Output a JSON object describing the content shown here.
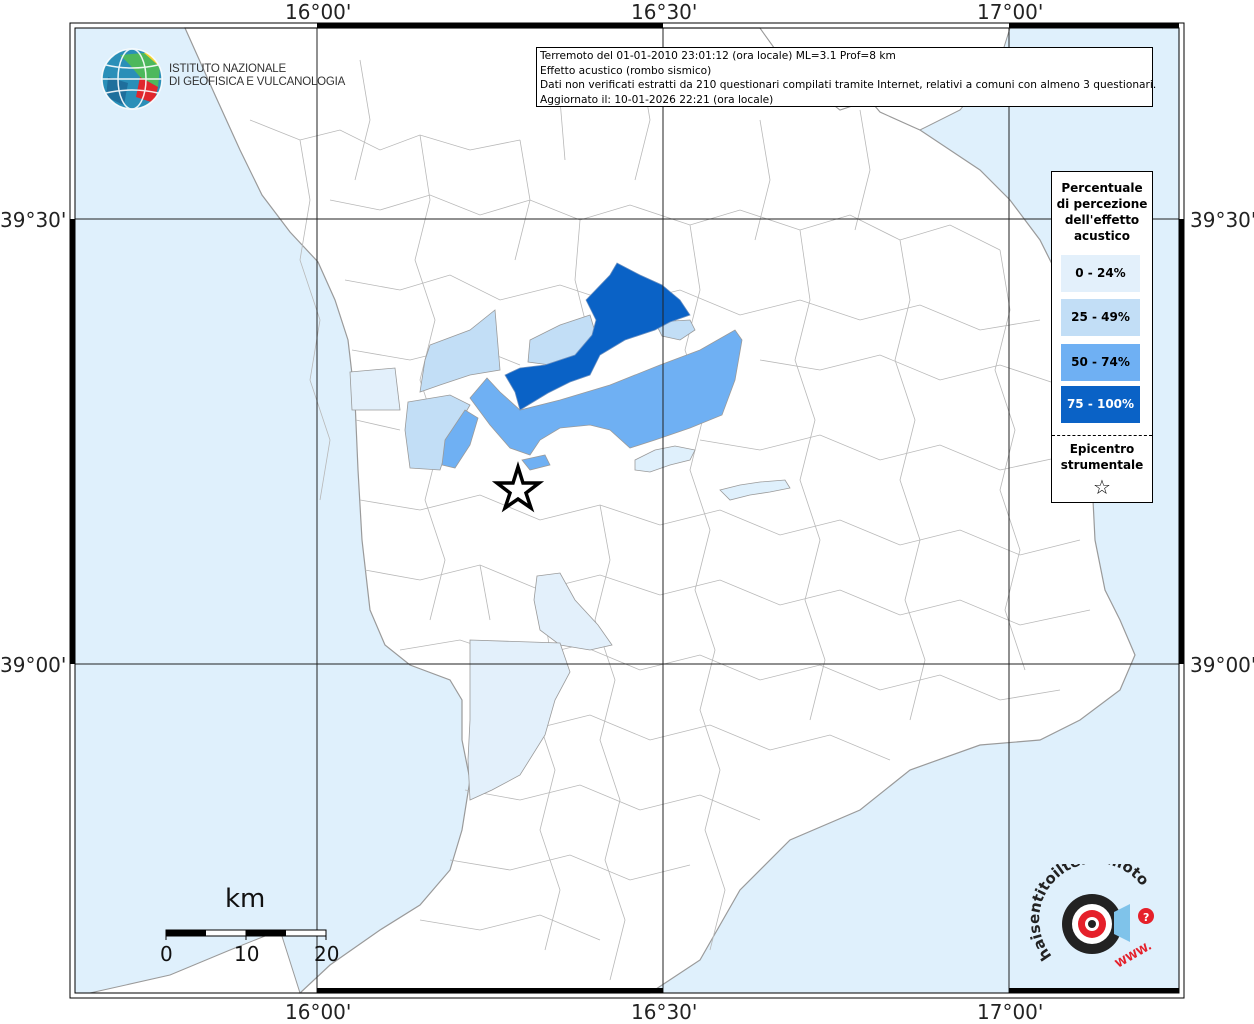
{
  "info": {
    "line1": "Terremoto del 01-01-2010 23:01:12 (ora locale) ML=3.1 Prof=8 km",
    "line2": "Effetto acustico (rombo sismico)",
    "line3": "Dati non verificati estratti da 210 questionari compilati tramite Internet, relativi a comuni con almeno 3 questionari.",
    "line4": "Aggiornato il: 10-01-2026 22:21 (ora locale)"
  },
  "coords": {
    "lon_1600": "16°00'",
    "lon_1630": "16°30'",
    "lon_1700": "17°00'",
    "lat_3930": "39°30'",
    "lat_3900": "39°00'"
  },
  "legend": {
    "title_1": "Percentuale",
    "title_2": "di percezione",
    "title_3": "dell'effetto",
    "title_4": "acustico",
    "items": [
      {
        "label": "0 - 24%",
        "color": "#e3f0fb"
      },
      {
        "label": "25 - 49%",
        "color": "#c2def6"
      },
      {
        "label": "50 - 74%",
        "color": "#6fb0f3"
      },
      {
        "label": "75 - 100%",
        "color": "#0a62c6"
      }
    ],
    "epicenter_1": "Epicentro",
    "epicenter_2": "strumentale",
    "star": "☆"
  },
  "ingv": {
    "line1": "ISTITUTO NAZIONALE",
    "line2": "DI GEOFISICA E VULCANOLOGIA"
  },
  "scale": {
    "unit": "km",
    "l0": "0",
    "l10": "10",
    "l20": "20"
  },
  "hsit": {
    "text": "haisentitoilterremoto.it",
    "www": "WWW."
  },
  "colors": {
    "sea": "#dff0fc",
    "land": "#ffffff",
    "border": "#8c8c8c",
    "grid": "#222222"
  }
}
